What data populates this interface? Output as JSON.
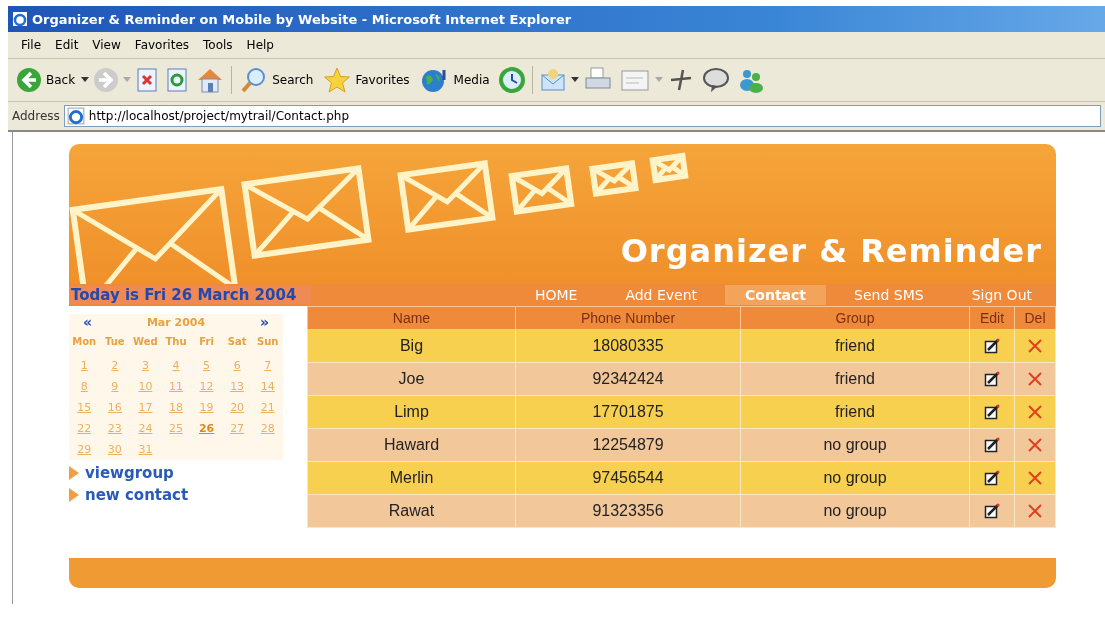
{
  "window": {
    "title": "Organizer & Reminder on Mobile by Website - Microsoft Internet Explorer"
  },
  "menu": [
    "File",
    "Edit",
    "View",
    "Favorites",
    "Tools",
    "Help"
  ],
  "toolbar": {
    "back": "Back",
    "search": "Search",
    "favorites": "Favorites",
    "media": "Media"
  },
  "address": {
    "label": "Address",
    "url": "http://localhost/project/mytrail/Contact.php"
  },
  "banner": {
    "title": "Organizer & Reminder"
  },
  "today": "Today is Fri 26 March 2004",
  "nav": [
    {
      "label": "HOME",
      "selected": false
    },
    {
      "label": "Add Event",
      "selected": false
    },
    {
      "label": "Contact",
      "selected": true
    },
    {
      "label": "Send SMS",
      "selected": false
    },
    {
      "label": "Sign Out",
      "selected": false
    }
  ],
  "calendar": {
    "prev": "«",
    "month": "Mar 2004",
    "next": "»",
    "weekdays": [
      "Mon",
      "Tue",
      "Wed",
      "Thu",
      "Fri",
      "Sat",
      "Sun"
    ],
    "weeks": [
      [
        {
          "day": "1",
          "selected": false
        },
        {
          "day": "2",
          "selected": false
        },
        {
          "day": "3",
          "selected": false
        },
        {
          "day": "4",
          "selected": false
        },
        {
          "day": "5",
          "selected": false
        },
        {
          "day": "6",
          "selected": false
        },
        {
          "day": "7",
          "selected": false
        }
      ],
      [
        {
          "day": "8",
          "selected": false
        },
        {
          "day": "9",
          "selected": false
        },
        {
          "day": "10",
          "selected": false
        },
        {
          "day": "11",
          "selected": false
        },
        {
          "day": "12",
          "selected": false
        },
        {
          "day": "13",
          "selected": false
        },
        {
          "day": "14",
          "selected": false
        }
      ],
      [
        {
          "day": "15",
          "selected": false
        },
        {
          "day": "16",
          "selected": false
        },
        {
          "day": "17",
          "selected": false
        },
        {
          "day": "18",
          "selected": false
        },
        {
          "day": "19",
          "selected": false
        },
        {
          "day": "20",
          "selected": false
        },
        {
          "day": "21",
          "selected": false
        }
      ],
      [
        {
          "day": "22",
          "selected": false
        },
        {
          "day": "23",
          "selected": false
        },
        {
          "day": "24",
          "selected": false
        },
        {
          "day": "25",
          "selected": false
        },
        {
          "day": "26",
          "selected": true
        },
        {
          "day": "27",
          "selected": false
        },
        {
          "day": "28",
          "selected": false
        }
      ],
      [
        {
          "day": "29",
          "selected": false
        },
        {
          "day": "30",
          "selected": false
        },
        {
          "day": "31",
          "selected": false
        }
      ]
    ]
  },
  "links": [
    "viewgroup",
    "new contact"
  ],
  "table": {
    "columns": [
      "Name",
      "Phone Number",
      "Group",
      "Edit",
      "Del"
    ],
    "rows": [
      {
        "name": "Big",
        "phone": "18080335",
        "group": "friend"
      },
      {
        "name": "Joe",
        "phone": "92342424",
        "group": "friend"
      },
      {
        "name": "Limp",
        "phone": "17701875",
        "group": "friend"
      },
      {
        "name": "Haward",
        "phone": "12254879",
        "group": "no group"
      },
      {
        "name": "Merlin",
        "phone": "97456544",
        "group": "no group"
      },
      {
        "name": "Rawat",
        "phone": "91323356",
        "group": "no group"
      }
    ]
  }
}
